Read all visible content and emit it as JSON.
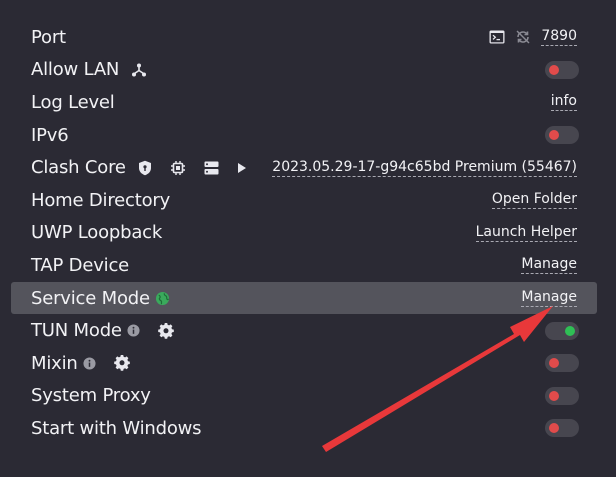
{
  "settings": {
    "port": {
      "label": "Port",
      "value": "7890"
    },
    "allow_lan": {
      "label": "Allow LAN",
      "enabled": false
    },
    "log_level": {
      "label": "Log Level",
      "value": "info"
    },
    "ipv6": {
      "label": "IPv6",
      "enabled": false
    },
    "clash_core": {
      "label": "Clash Core",
      "value": "2023.05.29-17-g94c65bd Premium (55467)"
    },
    "home_directory": {
      "label": "Home Directory",
      "action": "Open Folder"
    },
    "uwp_loopback": {
      "label": "UWP Loopback",
      "action": "Launch Helper"
    },
    "tap_device": {
      "label": "TAP Device",
      "action": "Manage"
    },
    "service_mode": {
      "label": "Service Mode",
      "action": "Manage"
    },
    "tun_mode": {
      "label": "TUN Mode",
      "enabled": true
    },
    "mixin": {
      "label": "Mixin",
      "enabled": false
    },
    "system_proxy": {
      "label": "System Proxy",
      "enabled": false
    },
    "start_with_windows": {
      "label": "Start with Windows",
      "enabled": false
    }
  },
  "icons": {
    "terminal": "terminal-icon",
    "refresh": "random-port-icon",
    "lan": "network-icon",
    "shield": "shield-icon",
    "chip": "chip-icon",
    "server": "server-icon",
    "play": "play-icon",
    "globe": "globe-icon",
    "info": "info-icon",
    "gear": "gear-icon"
  },
  "colors": {
    "background": "#2b2a34",
    "highlight_row": "#54545c",
    "toggle_off": "#e14b4b",
    "toggle_on": "#2fbf55",
    "toggle_track": "#47464f",
    "globe": "#3aaa5c",
    "annotation_arrow": "#e8383a"
  }
}
